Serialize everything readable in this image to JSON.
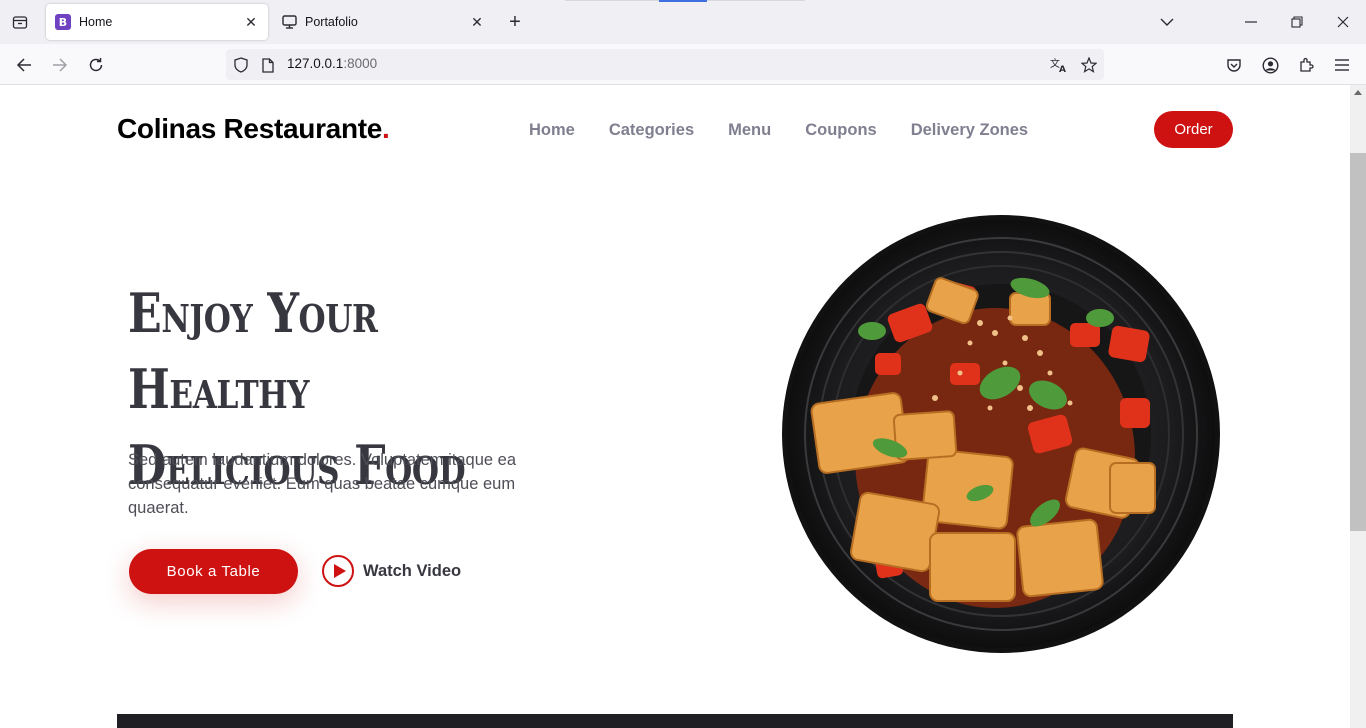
{
  "browser": {
    "tabs": [
      {
        "title": "Home",
        "favicon": "bootstrap-icon",
        "active": true
      },
      {
        "title": "Portafolio",
        "favicon": "monitor-icon",
        "active": false
      }
    ],
    "url_host": "127.0.0.1",
    "url_port": ":8000"
  },
  "site": {
    "logo_text": "Colinas Restaurante",
    "logo_dot": ".",
    "nav": [
      "Home",
      "Categories",
      "Menu",
      "Coupons",
      "Delivery Zones"
    ],
    "order_label": "Order",
    "accent": "#ce1212"
  },
  "hero": {
    "title_line1": "Enjoy Your Healthy",
    "title_line2": "Delicious Food",
    "text": "Sed autem laudantium dolores. Voluptatem itaque ea consequatur eveniet. Eum quas beatae cumque eum quaerat.",
    "book_label": "Book a Table",
    "watch_label": "Watch Video",
    "image": "food-plate-image"
  }
}
